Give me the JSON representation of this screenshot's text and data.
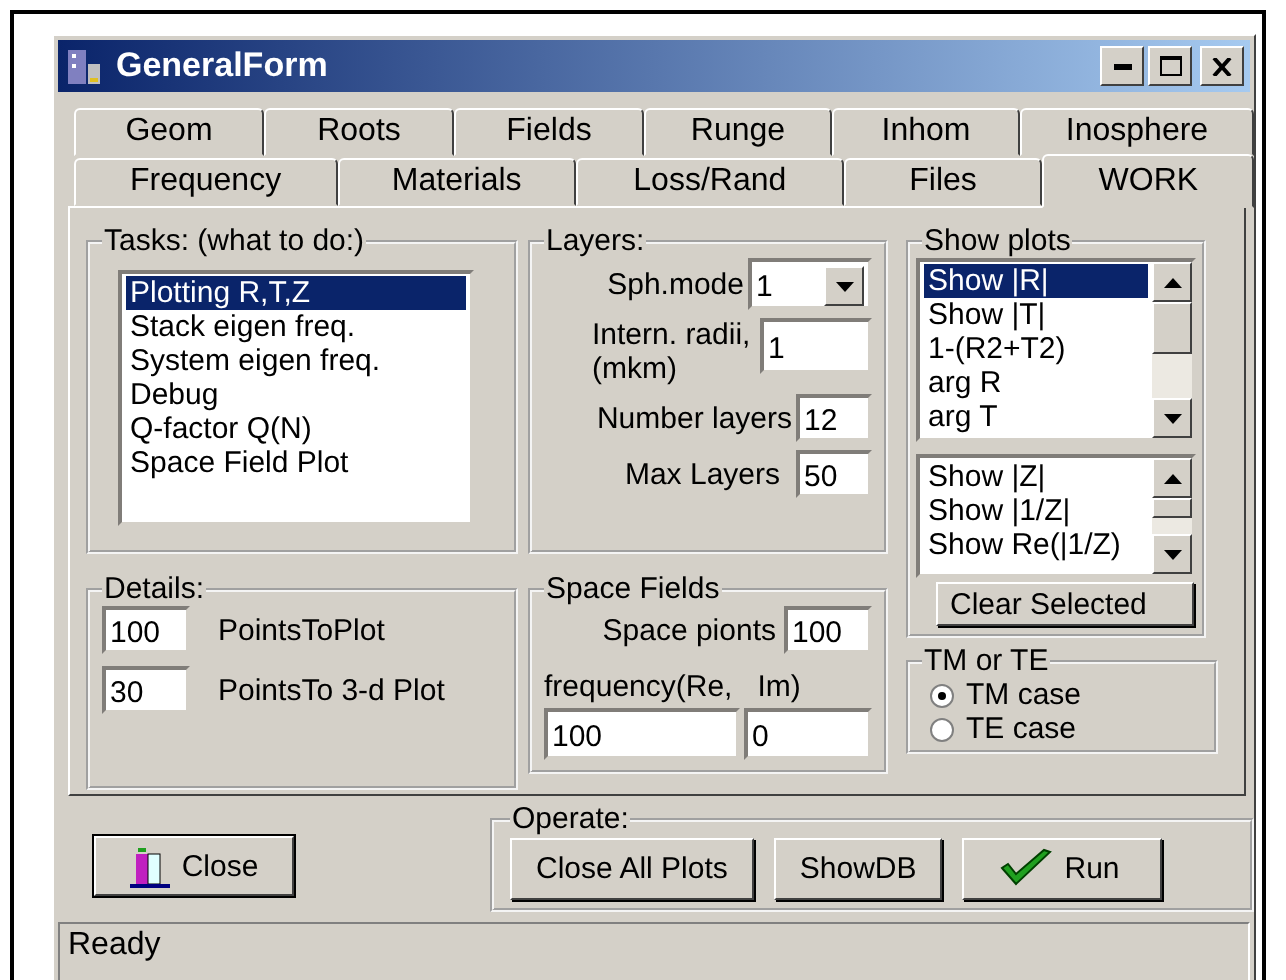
{
  "window": {
    "title": "GeneralForm"
  },
  "tabs_row1": [
    {
      "label": "Geom",
      "selected": false
    },
    {
      "label": "Roots",
      "selected": false
    },
    {
      "label": "Fields",
      "selected": false
    },
    {
      "label": "Runge",
      "selected": false
    },
    {
      "label": "Inhom",
      "selected": false
    },
    {
      "label": "Inosphere",
      "selected": false
    }
  ],
  "tabs_row2": [
    {
      "label": "Frequency",
      "selected": false
    },
    {
      "label": "Materials",
      "selected": false
    },
    {
      "label": "Loss/Rand",
      "selected": false
    },
    {
      "label": "Files",
      "selected": false
    },
    {
      "label": "WORK",
      "selected": true
    }
  ],
  "tasks": {
    "label": "Tasks:  (what to do:)",
    "items": [
      {
        "label": "Plotting R,T,Z",
        "selected": true
      },
      {
        "label": "Stack eigen freq.",
        "selected": false
      },
      {
        "label": "System  eigen freq.",
        "selected": false
      },
      {
        "label": "Debug",
        "selected": false
      },
      {
        "label": "Q-factor Q(N)",
        "selected": false
      },
      {
        "label": "Space Field Plot",
        "selected": false
      }
    ]
  },
  "layers": {
    "label": "Layers:",
    "sph_mode": {
      "label": "Sph.mode",
      "value": "1"
    },
    "intern_radii": {
      "label": "Intern. radii,(mkm)",
      "value": "1"
    },
    "number_layers": {
      "label": "Number layers",
      "value": "12"
    },
    "max_layers": {
      "label": "Max Layers",
      "value": "50"
    }
  },
  "show_plots": {
    "label": "Show plots",
    "list_1": [
      {
        "label": "Show |R|",
        "selected": true
      },
      {
        "label": "Show |T|",
        "selected": false
      },
      {
        "label": "1-(R2+T2)",
        "selected": false
      },
      {
        "label": "arg R",
        "selected": false
      },
      {
        "label": "arg T",
        "selected": false
      }
    ],
    "list_2": [
      {
        "label": "Show |Z|",
        "selected": false
      },
      {
        "label": "Show |1/Z|",
        "selected": false
      },
      {
        "label": "Show Re(|1/Z)",
        "selected": false
      }
    ],
    "clear_button": "Clear Selected"
  },
  "details": {
    "label": "Details:",
    "fields": [
      {
        "value": "100",
        "label": "PointsToPlot"
      },
      {
        "value": "30",
        "label": "PointsTo 3-d Plot"
      }
    ]
  },
  "space_fields": {
    "label": "Space Fields",
    "space_points": {
      "label": "Space pionts",
      "value": "100"
    },
    "frequency_label": "frequency(Re,   Im)",
    "frequency_re": "100",
    "frequency_im": "0"
  },
  "tm_or_te": {
    "label": "TM or TE",
    "options": [
      {
        "label": "TM case",
        "selected": true
      },
      {
        "label": "TE case",
        "selected": false
      }
    ]
  },
  "close_button": "Close",
  "operate": {
    "label": "Operate:",
    "buttons": [
      {
        "label": "Close All Plots",
        "kind": "plain"
      },
      {
        "label": "ShowDB",
        "kind": "plain"
      },
      {
        "label": "Run",
        "kind": "check"
      }
    ]
  },
  "status_bar": "Ready"
}
